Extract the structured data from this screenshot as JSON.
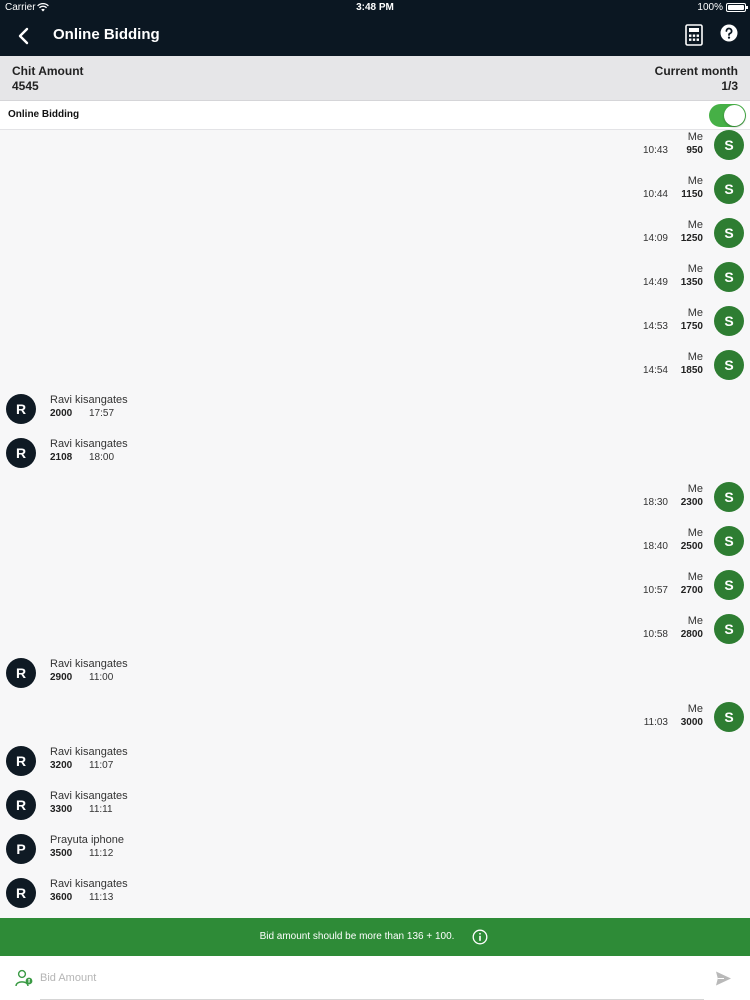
{
  "status_bar": {
    "carrier": "Carrier",
    "time": "3:48 PM",
    "battery": "100%"
  },
  "nav": {
    "title": "Online Bidding"
  },
  "info": {
    "chit_amount_label": "Chit Amount",
    "chit_amount_value": "4545",
    "current_month_label": "Current month",
    "current_month_value": "1/3"
  },
  "online_bidding": {
    "label": "Online Bidding",
    "enabled": true,
    "accent": "#46b046"
  },
  "colors": {
    "me_avatar": "#2e7d32",
    "other_avatar": "#0f1a24",
    "banner": "#2e8b37",
    "header": "#0b1722"
  },
  "messages": [
    {
      "side": "me",
      "initial": "S",
      "name": "Me",
      "amount": "950",
      "time": "10:43"
    },
    {
      "side": "me",
      "initial": "S",
      "name": "Me",
      "amount": "1150",
      "time": "10:44"
    },
    {
      "side": "me",
      "initial": "S",
      "name": "Me",
      "amount": "1250",
      "time": "14:09"
    },
    {
      "side": "me",
      "initial": "S",
      "name": "Me",
      "amount": "1350",
      "time": "14:49"
    },
    {
      "side": "me",
      "initial": "S",
      "name": "Me",
      "amount": "1750",
      "time": "14:53"
    },
    {
      "side": "me",
      "initial": "S",
      "name": "Me",
      "amount": "1850",
      "time": "14:54"
    },
    {
      "side": "other",
      "initial": "R",
      "name": "Ravi kisangates",
      "amount": "2000",
      "time": "17:57"
    },
    {
      "side": "other",
      "initial": "R",
      "name": "Ravi kisangates",
      "amount": "2108",
      "time": "18:00"
    },
    {
      "side": "me",
      "initial": "S",
      "name": "Me",
      "amount": "2300",
      "time": "18:30"
    },
    {
      "side": "me",
      "initial": "S",
      "name": "Me",
      "amount": "2500",
      "time": "18:40"
    },
    {
      "side": "me",
      "initial": "S",
      "name": "Me",
      "amount": "2700",
      "time": "10:57"
    },
    {
      "side": "me",
      "initial": "S",
      "name": "Me",
      "amount": "2800",
      "time": "10:58"
    },
    {
      "side": "other",
      "initial": "R",
      "name": "Ravi kisangates",
      "amount": "2900",
      "time": "11:00"
    },
    {
      "side": "me",
      "initial": "S",
      "name": "Me",
      "amount": "3000",
      "time": "11:03"
    },
    {
      "side": "other",
      "initial": "R",
      "name": "Ravi kisangates",
      "amount": "3200",
      "time": "11:07"
    },
    {
      "side": "other",
      "initial": "R",
      "name": "Ravi kisangates",
      "amount": "3300",
      "time": "11:11"
    },
    {
      "side": "other",
      "initial": "P",
      "name": "Prayuta iphone",
      "amount": "3500",
      "time": "11:12"
    },
    {
      "side": "other",
      "initial": "R",
      "name": "Ravi kisangates",
      "amount": "3600",
      "time": "11:13"
    }
  ],
  "banner": {
    "text": "Bid amount should be more than 136 + 100."
  },
  "input": {
    "placeholder": "Bid Amount",
    "value": ""
  },
  "icons": {
    "back": "chevron-left-icon",
    "calculator": "calculator-icon",
    "help": "help-icon",
    "info": "info-icon",
    "bidder": "person-icon",
    "send": "send-icon"
  }
}
